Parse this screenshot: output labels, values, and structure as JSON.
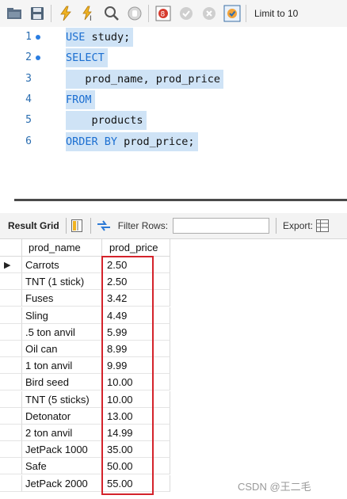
{
  "toolbar": {
    "icons": [
      "open-folder-icon",
      "save-icon",
      "execute-icon",
      "execute-current-icon",
      "explain-icon",
      "stop-icon",
      "toggle-error-icon",
      "commit-icon",
      "rollback-icon",
      "autocommit-icon"
    ],
    "limit_label": "Limit to 10"
  },
  "editor": {
    "lines": [
      {
        "number": "1",
        "dot": true,
        "tokens": [
          {
            "t": "USE",
            "kw": true
          },
          {
            "t": " study;",
            "kw": false
          }
        ]
      },
      {
        "number": "2",
        "dot": true,
        "tokens": [
          {
            "t": "SELECT",
            "kw": true
          }
        ]
      },
      {
        "number": "3",
        "dot": false,
        "tokens": [
          {
            "t": "   prod_name, prod_price",
            "kw": false
          }
        ]
      },
      {
        "number": "4",
        "dot": false,
        "tokens": [
          {
            "t": "FROM",
            "kw": true
          }
        ]
      },
      {
        "number": "5",
        "dot": false,
        "tokens": [
          {
            "t": "    products",
            "kw": false
          }
        ]
      },
      {
        "number": "6",
        "dot": false,
        "tokens": [
          {
            "t": "ORDER BY",
            "kw": true
          },
          {
            "t": " prod_price;",
            "kw": false
          }
        ]
      }
    ]
  },
  "result_toolbar": {
    "result_grid_label": "Result Grid",
    "filter_label": "Filter Rows:",
    "filter_value": "",
    "export_label": "Export:"
  },
  "grid": {
    "columns": [
      "prod_name",
      "prod_price"
    ],
    "rows": [
      [
        "Carrots",
        "2.50"
      ],
      [
        "TNT (1 stick)",
        "2.50"
      ],
      [
        "Fuses",
        "3.42"
      ],
      [
        "Sling",
        "4.49"
      ],
      [
        ".5 ton anvil",
        "5.99"
      ],
      [
        "Oil can",
        "8.99"
      ],
      [
        "1 ton anvil",
        "9.99"
      ],
      [
        "Bird seed",
        "10.00"
      ],
      [
        "TNT (5 sticks)",
        "10.00"
      ],
      [
        "Detonator",
        "13.00"
      ],
      [
        "2 ton anvil",
        "14.99"
      ],
      [
        "JetPack 1000",
        "35.00"
      ],
      [
        "Safe",
        "50.00"
      ],
      [
        "JetPack 2000",
        "55.00"
      ]
    ],
    "current_row_marker": "▶"
  },
  "watermark": "CSDN @王二毛",
  "colors": {
    "highlight": "#cfe3f6",
    "keyword": "#1c6fd1",
    "annotation": "#d4232b"
  }
}
